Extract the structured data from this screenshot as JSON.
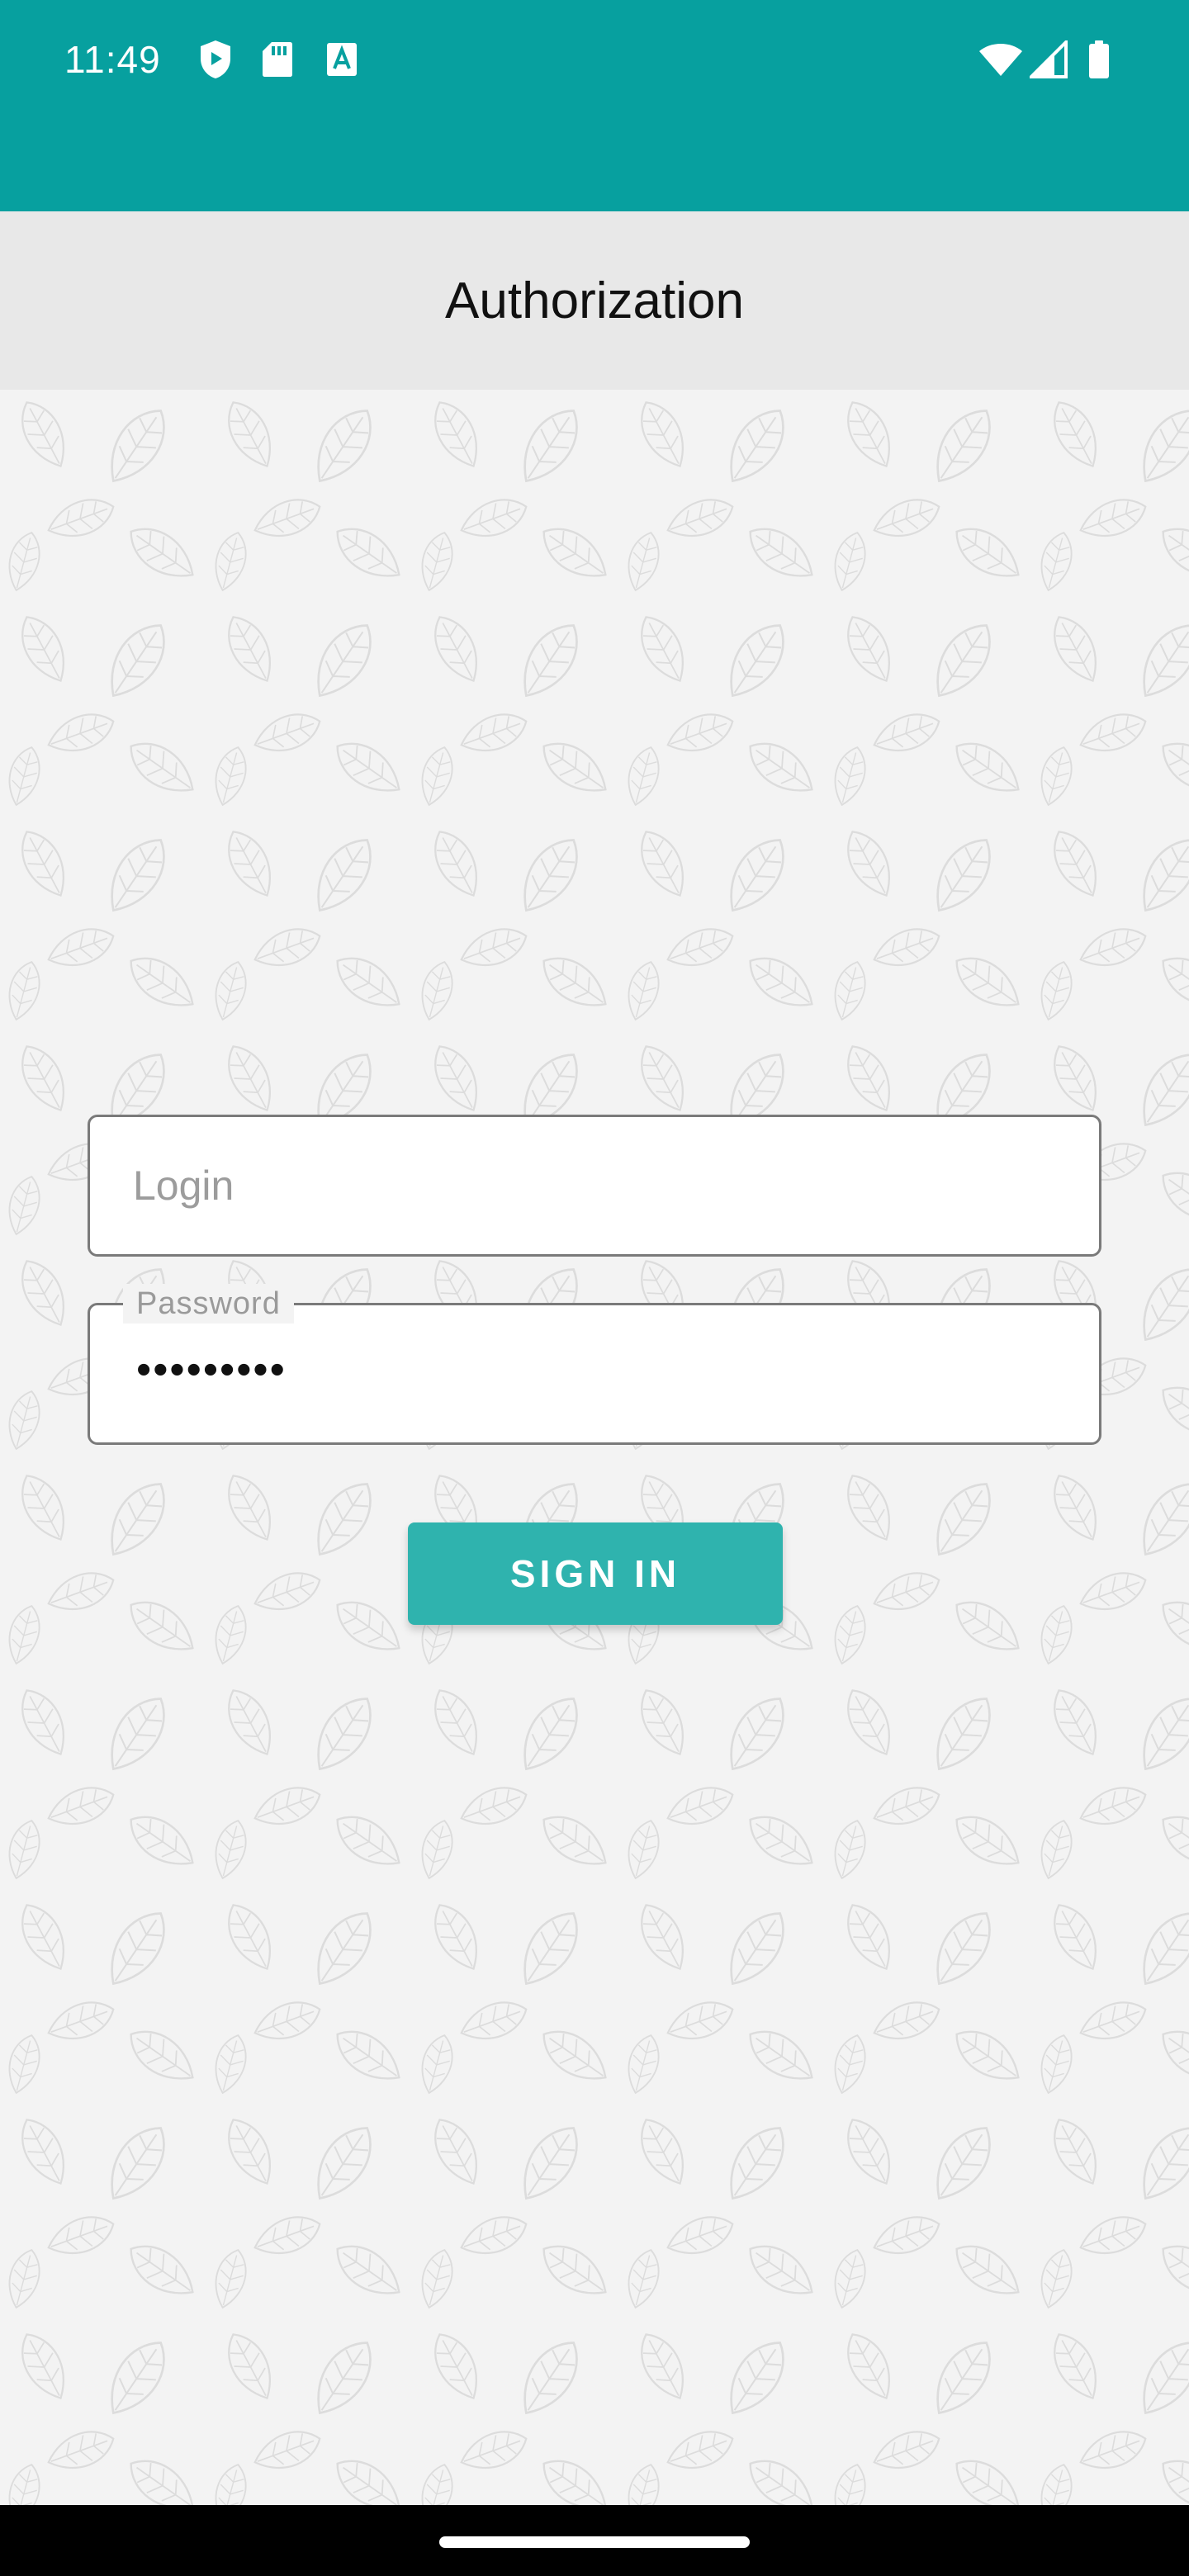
{
  "status_bar": {
    "time": "11:49",
    "left_icons": [
      "shield-icon",
      "sd-card-icon",
      "text-a-icon"
    ],
    "right_icons": [
      "wifi-icon",
      "cell-signal-icon",
      "battery-icon"
    ]
  },
  "title_bar": {
    "title": "Authorization"
  },
  "login_form": {
    "login_placeholder": "Login",
    "password_label": "Password",
    "password_value": "•••••••••",
    "sign_in_label": "SIGN IN"
  },
  "colors": {
    "status_bar": "#07a09f",
    "title_bar": "#e8e8e8",
    "background": "#f3f3f3",
    "accent_button": "#2fb3ae"
  }
}
